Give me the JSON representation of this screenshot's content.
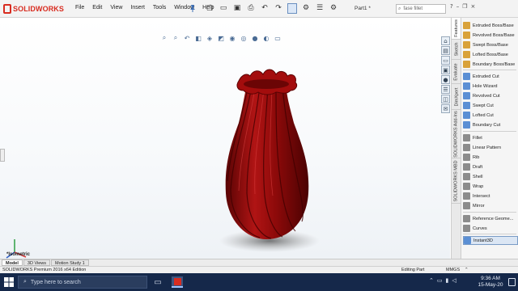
{
  "app": {
    "brand": "SOLIDWORKS",
    "document_name": "Part1 *",
    "accent_color": "#d82c20"
  },
  "menu": [
    "File",
    "Edit",
    "View",
    "Insert",
    "Tools",
    "Window",
    "Help"
  ],
  "search": {
    "value": "fase fillet"
  },
  "viewport": {
    "view_orientation": "*Isometric",
    "model_color": "#9b0a0a",
    "model_name": "twisted-vase"
  },
  "command_tabs": [
    "Features",
    "Sketch",
    "Evaluate",
    "DimXpert",
    "SOLIDWORKS Add-Ins",
    "SOLIDWORKS MBD"
  ],
  "commands": [
    {
      "label": "Extruded Boss/Base",
      "color": "#d9a23a"
    },
    {
      "label": "Revolved Boss/Base",
      "color": "#d9a23a"
    },
    {
      "label": "Swept Boss/Base",
      "color": "#d9a23a"
    },
    {
      "label": "Lofted Boss/Base",
      "color": "#d9a23a"
    },
    {
      "label": "Boundary Boss/Base",
      "color": "#d9a23a"
    },
    {
      "label": "Extruded Cut",
      "color": "#5b8fd4"
    },
    {
      "label": "Hole Wizard",
      "color": "#5b8fd4"
    },
    {
      "label": "Revolved Cut",
      "color": "#5b8fd4"
    },
    {
      "label": "Swept Cut",
      "color": "#5b8fd4"
    },
    {
      "label": "Lofted Cut",
      "color": "#5b8fd4"
    },
    {
      "label": "Boundary Cut",
      "color": "#5b8fd4"
    },
    {
      "label": "Fillet",
      "color": "#8c8c8c"
    },
    {
      "label": "Linear Pattern",
      "color": "#8c8c8c"
    },
    {
      "label": "Rib",
      "color": "#8c8c8c"
    },
    {
      "label": "Draft",
      "color": "#8c8c8c"
    },
    {
      "label": "Shell",
      "color": "#8c8c8c"
    },
    {
      "label": "Wrap",
      "color": "#8c8c8c"
    },
    {
      "label": "Intersect",
      "color": "#8c8c8c"
    },
    {
      "label": "Mirror",
      "color": "#8c8c8c"
    },
    {
      "label": "Reference Geome...",
      "color": "#8c8c8c"
    },
    {
      "label": "Curves",
      "color": "#8c8c8c"
    },
    {
      "label": "Instant3D",
      "color": "#5b8fd4"
    }
  ],
  "bottom_tabs": [
    "Model",
    "3D Views",
    "Motion Study 1"
  ],
  "status": {
    "edition": "SOLIDWORKS Premium 2016 x64 Edition",
    "mode": "Editing Part",
    "units": "MMGS"
  },
  "taskbar": {
    "search_placeholder": "Type here to search",
    "time": "9:36 AM",
    "date": "15-May-20"
  }
}
